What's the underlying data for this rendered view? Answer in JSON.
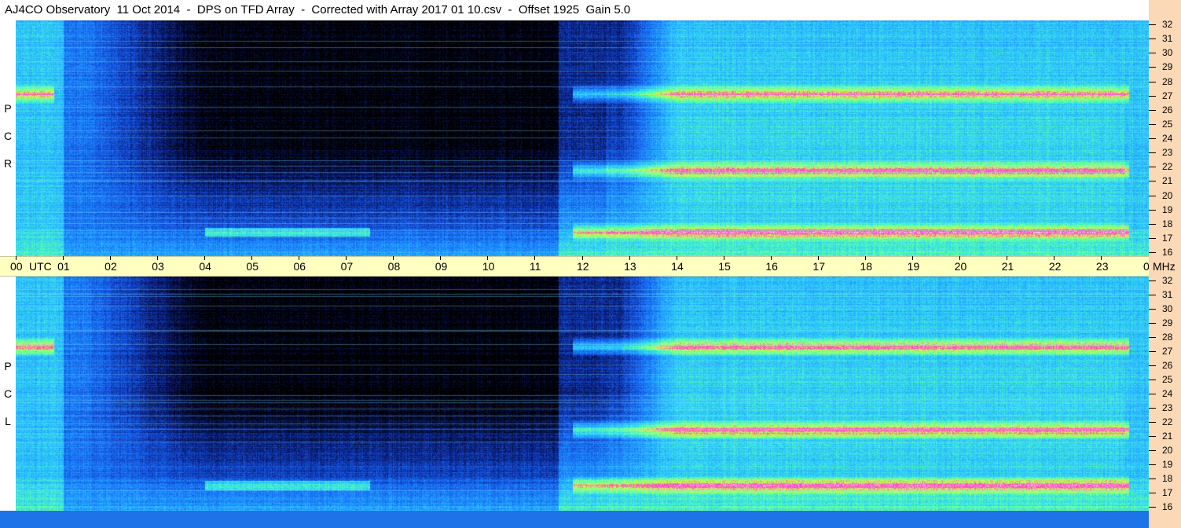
{
  "title": "AJ4CO Observatory  11 Oct 2014  -  DPS on TFD Array  -  Corrected with Array 2017 01 10.csv  -  Offset 1925  Gain 5.0",
  "chart_data": [
    {
      "type": "heatmap",
      "panel": "RCP",
      "polarization_label": [
        "R",
        "C",
        "P"
      ],
      "x_label": "UTC",
      "x_range": [
        0,
        24
      ],
      "y_label": "MHz",
      "y_range": [
        16,
        32
      ],
      "colormap": [
        "#000000",
        "#0a1a6e",
        "#1450dc",
        "#1e8cff",
        "#2ec8ff",
        "#50ffb4",
        "#c8ff50",
        "#ff3cc8",
        "#ffffff"
      ],
      "features": {
        "quiet_dark_period_utc": [
          3,
          13
        ],
        "emission_band_centers_mhz": [
          27,
          21.8,
          17.6
        ]
      }
    },
    {
      "type": "heatmap",
      "panel": "LCP",
      "polarization_label": [
        "L",
        "C",
        "P"
      ],
      "x_label": "UTC",
      "x_range": [
        0,
        24
      ],
      "y_label": "MHz",
      "y_range": [
        16,
        32
      ],
      "colormap": [
        "#000000",
        "#0a1a6e",
        "#1450dc",
        "#1e8cff",
        "#2ec8ff",
        "#50ffb4",
        "#c8ff50",
        "#ff3cc8",
        "#ffffff"
      ],
      "features": {
        "quiet_dark_period_utc": [
          3,
          13
        ],
        "emission_band_centers_mhz": [
          27.2,
          21.5,
          17.7
        ]
      }
    }
  ],
  "time_axis": {
    "labels": [
      "00",
      "01",
      "02",
      "03",
      "04",
      "05",
      "06",
      "07",
      "08",
      "09",
      "10",
      "11",
      "12",
      "13",
      "14",
      "15",
      "16",
      "17",
      "18",
      "19",
      "20",
      "21",
      "22",
      "23",
      "00"
    ],
    "unit_left": "UTC",
    "unit_right": "MHz"
  },
  "freq_axis": {
    "labels": [
      "32",
      "31",
      "30",
      "29",
      "28",
      "27",
      "26",
      "25",
      "24",
      "23",
      "22",
      "21",
      "20",
      "19",
      "18",
      "17",
      "16"
    ]
  }
}
